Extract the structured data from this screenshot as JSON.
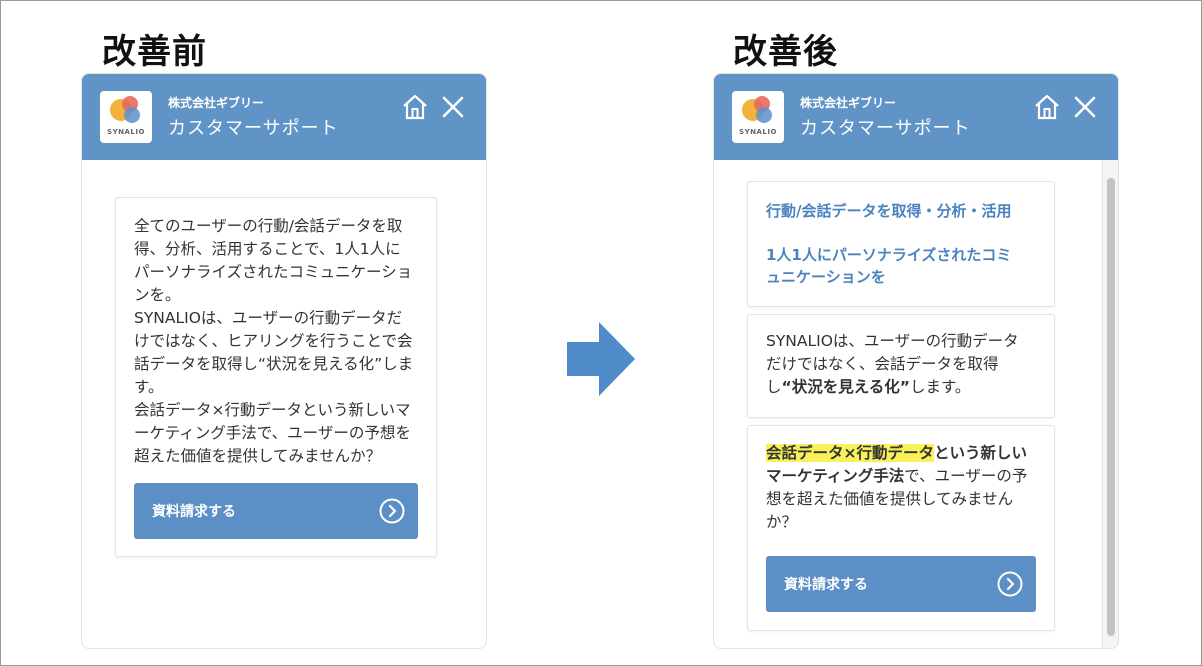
{
  "before": {
    "title": "改善前",
    "company": "株式会社ギブリー",
    "support_title": "カスタマーサポート",
    "logo_text": "SYNALIO",
    "message": "全てのユーザーの行動/会話データを取\n得、分析、活用することで、1人1人に\nパーソナライズされたコミュニケーショ\nンを。\nSYNALIOは、ユーザーの行動データだ\nけではなく、ヒアリングを行うことで会\n話データを取得し“状況を見える化”しま\nす。\n会話データ×行動データという新しいマ\nーケティング手法で、ユーザーの予想を\n超えた価値を提供してみませんか？",
    "cta_label": "資料請求する"
  },
  "after": {
    "title": "改善後",
    "company": "株式会社ギブリー",
    "support_title": "カスタマーサポート",
    "logo_text": "SYNALIO",
    "headline_1": "行動/会話データを取得・分析・活用",
    "headline_2": "1人1人にパーソナライズされたコミ\nュニケーションを",
    "para2_start": "SYNALIOは、ユーザーの行動データ\nだけではなく、会話データを取得\nし",
    "para2_bold": "“状況を見える化”",
    "para2_end": "します。",
    "para3_highlight": "会話データ×行動データ",
    "para3_bold": "という新しい\nマーケティング手法",
    "para3_end": "で、ユーザーの予\n想を超えた価値を提供してみません\nか？",
    "cta_label": "資料請求する"
  },
  "colors": {
    "header": "#6194c6",
    "button": "#5b8fc6",
    "accent_text": "#4a83c0",
    "highlight": "#f9f15a",
    "arrow": "#4f8bc9"
  },
  "icons": [
    "home-icon",
    "close-icon",
    "chevron-right-circle-icon",
    "arrow-right-icon"
  ]
}
